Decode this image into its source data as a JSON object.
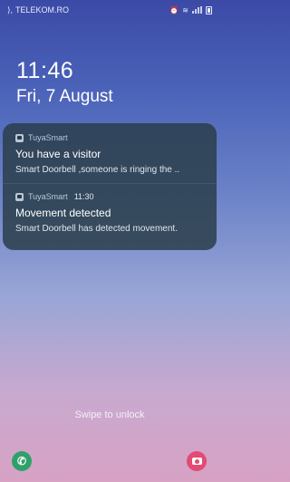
{
  "status_bar": {
    "carrier": "TELEKOM.RO",
    "icons": [
      "alarm-icon",
      "wifi-icon",
      "signal-icon",
      "battery-icon"
    ]
  },
  "lockscreen": {
    "time": "11:46",
    "date": "Fri, 7 August",
    "swipe_hint": "Swipe to unlock"
  },
  "notifications": [
    {
      "app": "TuyaSmart",
      "time": "",
      "title": "You have a visitor",
      "body": "Smart Doorbell ,someone is ringing the .."
    },
    {
      "app": "TuyaSmart",
      "time": "11:30",
      "title": "Movement detected",
      "body": "Smart Doorbell has detected movement."
    }
  ],
  "shortcuts": {
    "left": "phone-icon",
    "right": "camera-icon"
  },
  "colors": {
    "phone_shortcut": "#2ea16b",
    "camera_shortcut": "#e34a74",
    "notification_panel": "#283c46"
  }
}
